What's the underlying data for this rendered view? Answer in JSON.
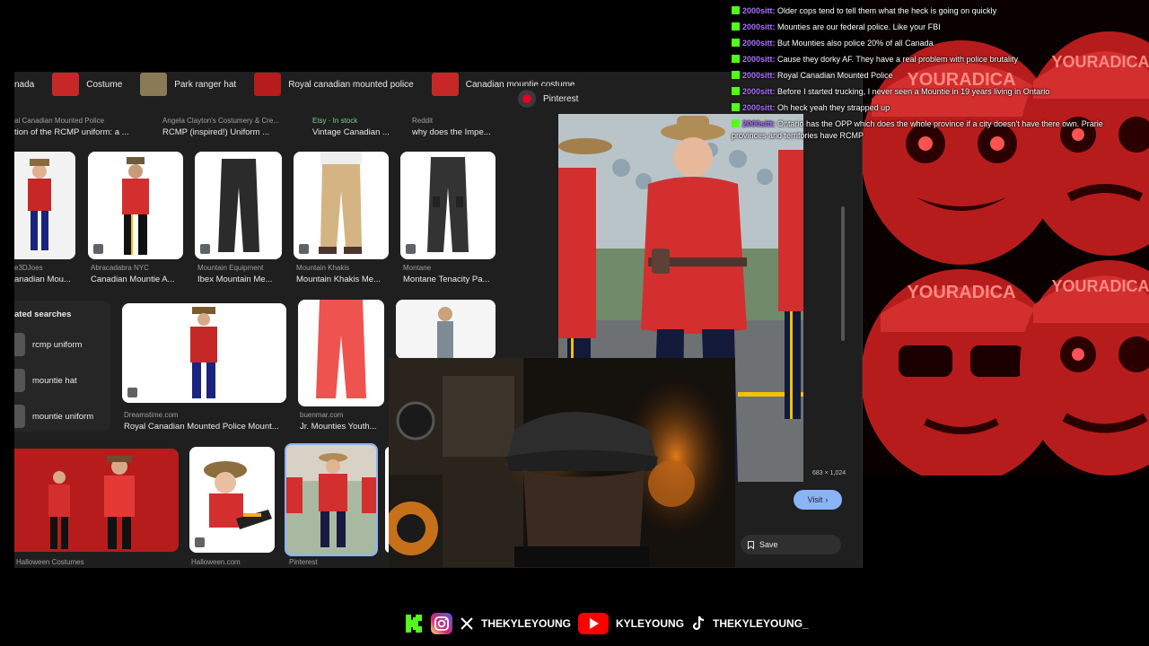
{
  "browser": {
    "chips": [
      {
        "label": "nada",
        "thumb_color": "#1f1f1f"
      },
      {
        "label": "Costume",
        "thumb_color": "#c62828"
      },
      {
        "label": "Park ranger hat",
        "thumb_color": "#8a7a55"
      },
      {
        "label": "Royal canadian mounted police",
        "thumb_color": "#b71c1c"
      },
      {
        "label": "Canadian mountie costume",
        "thumb_color": "#c62828"
      }
    ],
    "row1": [
      {
        "source": "al Canadian Mounted Police",
        "title": "tion of the RCMP uniform: a ..."
      },
      {
        "source": "Angela Clayton's Costumery & Cre...",
        "title": "RCMP (inspired!) Uniform ..."
      },
      {
        "source": "Etsy · In stock",
        "title": "Vintage Canadian ..."
      },
      {
        "source": "Reddit",
        "title": "why does the Impe..."
      }
    ],
    "row2": [
      {
        "source": "e3DJoes",
        "title": "anadian Mou..."
      },
      {
        "source": "Abracadabra NYC",
        "title": "Canadian Mountie A..."
      },
      {
        "source": "Mountain Equipment",
        "title": "Ibex Mountain Me..."
      },
      {
        "source": "Mountain Khakis",
        "title": "Mountain Khakis Me..."
      },
      {
        "source": "Montane",
        "title": "Montane Tenacity Pa..."
      }
    ],
    "related": {
      "heading": "ated searches",
      "items": [
        {
          "label": "rcmp uniform"
        },
        {
          "label": "mountie hat"
        },
        {
          "label": "mountie uniform"
        }
      ]
    },
    "row3": [
      {
        "source": "Dreamstime.com",
        "title": "Royal Canadian Mounted Police Mount..."
      },
      {
        "source": "buenmar.com",
        "title": "Jr. Mounties Youth..."
      }
    ],
    "row4": [
      {
        "source": "Halloween Costumes"
      },
      {
        "source": "Halloween.com"
      },
      {
        "source": "Pinterest"
      }
    ],
    "panel": {
      "source": "Pinterest",
      "dimensions": "683 × 1,024",
      "visit_label": "Visit",
      "save_label": "Save"
    }
  },
  "chat": [
    {
      "user": "2000sitt:",
      "text": "Older cops tend to tell them what the heck is going on quickly"
    },
    {
      "user": "2000sitt:",
      "text": "Mounties are our federal police. Like your FBI"
    },
    {
      "user": "2000sitt:",
      "text": "But Mounties also police 20% of all Canada"
    },
    {
      "user": "2000sitt:",
      "text": "Cause they dorky AF. They have a real problem with police brutality"
    },
    {
      "user": "2000sitt:",
      "text": "Royal Canadian Mounted Police"
    },
    {
      "user": "2000sitt:",
      "text": "Before I started trucking, I never seen a Mountie in 19 years living in Ontario"
    },
    {
      "user": "2000sitt:",
      "text": "Oh heck yeah they strapped up"
    },
    {
      "user": "2000sitt:",
      "text": "Ontario has the OPP which does the whole province if a city doesn't have there own. Prarie provinces and territories have RCMP"
    }
  ],
  "art": {
    "brand_text": "YOURADICA"
  },
  "socials": {
    "x_handle": "THEKYLEYOUNG",
    "youtube_handle": "KYLEYOUNG",
    "tiktok_handle": "THEKYLEYOUNG_"
  },
  "colors": {
    "kick": "#53fc18",
    "youtube": "#ff0000",
    "chat_user": "#a970ff",
    "visit": "#8ab4f8",
    "pinterest": "#e60023"
  }
}
